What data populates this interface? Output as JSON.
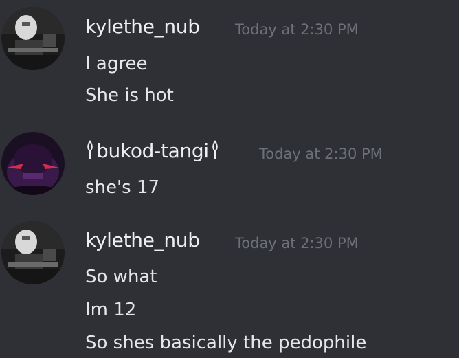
{
  "messages": [
    {
      "author": "kylethe_nub",
      "timestamp": "Today at 2:30 PM",
      "avatar": "user-avatar",
      "lines": [
        "I agree",
        "She is hot"
      ]
    },
    {
      "author": "bukod-tangi",
      "author_decoration": "candle-glyphs",
      "timestamp": "Today at 2:30 PM",
      "avatar": "user-avatar",
      "lines": [
        "she's 17"
      ]
    },
    {
      "author": "kylethe_nub",
      "timestamp": "Today at 2:30 PM",
      "avatar": "user-avatar",
      "lines": [
        "So what",
        "Im 12",
        "So shes basically the pedophile"
      ]
    }
  ],
  "colors": {
    "background": "#2e3035",
    "username": "#eceef0",
    "timestamp": "#6c7078",
    "message_text": "#e4e6e9"
  }
}
